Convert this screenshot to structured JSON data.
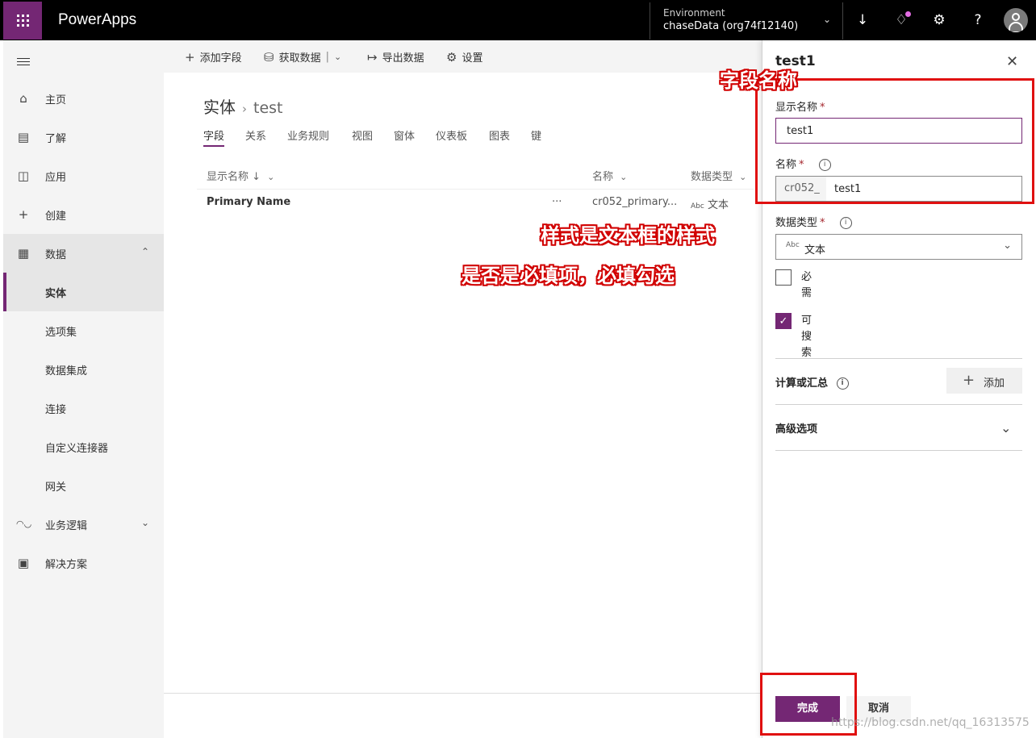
{
  "topbar": {
    "brand": "PowerApps",
    "environment_label": "Environment",
    "environment_value": "chaseData (org74f12140)"
  },
  "leftnav": {
    "items": [
      {
        "label": "主页",
        "icon": "home-icon"
      },
      {
        "label": "了解",
        "icon": "book-icon"
      },
      {
        "label": "应用",
        "icon": "apps-icon"
      },
      {
        "label": "创建",
        "icon": "plus-icon"
      },
      {
        "label": "数据",
        "icon": "table-icon"
      },
      {
        "label": "实体"
      },
      {
        "label": "选项集"
      },
      {
        "label": "数据集成"
      },
      {
        "label": "连接"
      },
      {
        "label": "自定义连接器"
      },
      {
        "label": "网关"
      },
      {
        "label": "业务逻辑",
        "icon": "flow-icon"
      },
      {
        "label": "解决方案",
        "icon": "solution-icon"
      }
    ]
  },
  "commandbar": {
    "add_field": "添加字段",
    "get_data": "获取数据",
    "export_data": "导出数据",
    "settings": "设置"
  },
  "main": {
    "breadcrumb_root": "实体",
    "breadcrumb_current": "test",
    "tabs": [
      "字段",
      "关系",
      "业务规则",
      "视图",
      "窗体",
      "仪表板",
      "图表",
      "键"
    ],
    "columns": {
      "display_name": "显示名称 ↓",
      "name": "名称",
      "data_type": "数据类型"
    },
    "rows": [
      {
        "display_name": "Primary Name",
        "more": "···",
        "name": "cr052_primary...",
        "data_type": "文本"
      }
    ]
  },
  "panel": {
    "title": "test1",
    "display_name_label": "显示名称",
    "display_name_value": "test1",
    "name_label": "名称",
    "name_prefix": "cr052_",
    "name_value": "test1",
    "data_type_label": "数据类型",
    "data_type_value": "文本",
    "required_label": "必需",
    "searchable_label": "可搜索",
    "required_checked": false,
    "searchable_checked": true,
    "calc_label": "计算或汇总",
    "add_label": "添加",
    "advanced_label": "高级选项",
    "done_label": "完成",
    "cancel_label": "取消",
    "required_mark": "*"
  },
  "annotations": {
    "field_name": "字段名称",
    "style_note": "样式是文本框的样式",
    "required_note": "是否是必填项，必填勾选"
  },
  "watermark": "https://blog.csdn.net/qq_16313575",
  "colors": {
    "accent": "#742774",
    "annotation": "#e01010"
  }
}
